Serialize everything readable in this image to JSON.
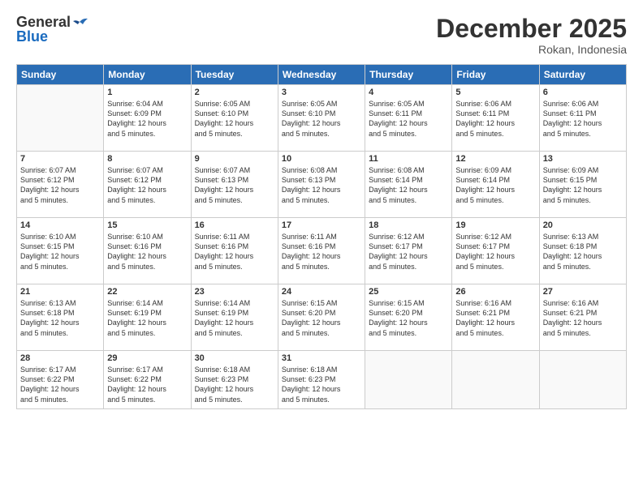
{
  "header": {
    "logo_general": "General",
    "logo_blue": "Blue",
    "month_title": "December 2025",
    "location": "Rokan, Indonesia"
  },
  "days_of_week": [
    "Sunday",
    "Monday",
    "Tuesday",
    "Wednesday",
    "Thursday",
    "Friday",
    "Saturday"
  ],
  "weeks": [
    [
      {
        "day": "",
        "info": ""
      },
      {
        "day": "1",
        "info": "Sunrise: 6:04 AM\nSunset: 6:09 PM\nDaylight: 12 hours\nand 5 minutes."
      },
      {
        "day": "2",
        "info": "Sunrise: 6:05 AM\nSunset: 6:10 PM\nDaylight: 12 hours\nand 5 minutes."
      },
      {
        "day": "3",
        "info": "Sunrise: 6:05 AM\nSunset: 6:10 PM\nDaylight: 12 hours\nand 5 minutes."
      },
      {
        "day": "4",
        "info": "Sunrise: 6:05 AM\nSunset: 6:11 PM\nDaylight: 12 hours\nand 5 minutes."
      },
      {
        "day": "5",
        "info": "Sunrise: 6:06 AM\nSunset: 6:11 PM\nDaylight: 12 hours\nand 5 minutes."
      },
      {
        "day": "6",
        "info": "Sunrise: 6:06 AM\nSunset: 6:11 PM\nDaylight: 12 hours\nand 5 minutes."
      }
    ],
    [
      {
        "day": "7",
        "info": "Sunrise: 6:07 AM\nSunset: 6:12 PM\nDaylight: 12 hours\nand 5 minutes."
      },
      {
        "day": "8",
        "info": "Sunrise: 6:07 AM\nSunset: 6:12 PM\nDaylight: 12 hours\nand 5 minutes."
      },
      {
        "day": "9",
        "info": "Sunrise: 6:07 AM\nSunset: 6:13 PM\nDaylight: 12 hours\nand 5 minutes."
      },
      {
        "day": "10",
        "info": "Sunrise: 6:08 AM\nSunset: 6:13 PM\nDaylight: 12 hours\nand 5 minutes."
      },
      {
        "day": "11",
        "info": "Sunrise: 6:08 AM\nSunset: 6:14 PM\nDaylight: 12 hours\nand 5 minutes."
      },
      {
        "day": "12",
        "info": "Sunrise: 6:09 AM\nSunset: 6:14 PM\nDaylight: 12 hours\nand 5 minutes."
      },
      {
        "day": "13",
        "info": "Sunrise: 6:09 AM\nSunset: 6:15 PM\nDaylight: 12 hours\nand 5 minutes."
      }
    ],
    [
      {
        "day": "14",
        "info": "Sunrise: 6:10 AM\nSunset: 6:15 PM\nDaylight: 12 hours\nand 5 minutes."
      },
      {
        "day": "15",
        "info": "Sunrise: 6:10 AM\nSunset: 6:16 PM\nDaylight: 12 hours\nand 5 minutes."
      },
      {
        "day": "16",
        "info": "Sunrise: 6:11 AM\nSunset: 6:16 PM\nDaylight: 12 hours\nand 5 minutes."
      },
      {
        "day": "17",
        "info": "Sunrise: 6:11 AM\nSunset: 6:16 PM\nDaylight: 12 hours\nand 5 minutes."
      },
      {
        "day": "18",
        "info": "Sunrise: 6:12 AM\nSunset: 6:17 PM\nDaylight: 12 hours\nand 5 minutes."
      },
      {
        "day": "19",
        "info": "Sunrise: 6:12 AM\nSunset: 6:17 PM\nDaylight: 12 hours\nand 5 minutes."
      },
      {
        "day": "20",
        "info": "Sunrise: 6:13 AM\nSunset: 6:18 PM\nDaylight: 12 hours\nand 5 minutes."
      }
    ],
    [
      {
        "day": "21",
        "info": "Sunrise: 6:13 AM\nSunset: 6:18 PM\nDaylight: 12 hours\nand 5 minutes."
      },
      {
        "day": "22",
        "info": "Sunrise: 6:14 AM\nSunset: 6:19 PM\nDaylight: 12 hours\nand 5 minutes."
      },
      {
        "day": "23",
        "info": "Sunrise: 6:14 AM\nSunset: 6:19 PM\nDaylight: 12 hours\nand 5 minutes."
      },
      {
        "day": "24",
        "info": "Sunrise: 6:15 AM\nSunset: 6:20 PM\nDaylight: 12 hours\nand 5 minutes."
      },
      {
        "day": "25",
        "info": "Sunrise: 6:15 AM\nSunset: 6:20 PM\nDaylight: 12 hours\nand 5 minutes."
      },
      {
        "day": "26",
        "info": "Sunrise: 6:16 AM\nSunset: 6:21 PM\nDaylight: 12 hours\nand 5 minutes."
      },
      {
        "day": "27",
        "info": "Sunrise: 6:16 AM\nSunset: 6:21 PM\nDaylight: 12 hours\nand 5 minutes."
      }
    ],
    [
      {
        "day": "28",
        "info": "Sunrise: 6:17 AM\nSunset: 6:22 PM\nDaylight: 12 hours\nand 5 minutes."
      },
      {
        "day": "29",
        "info": "Sunrise: 6:17 AM\nSunset: 6:22 PM\nDaylight: 12 hours\nand 5 minutes."
      },
      {
        "day": "30",
        "info": "Sunrise: 6:18 AM\nSunset: 6:23 PM\nDaylight: 12 hours\nand 5 minutes."
      },
      {
        "day": "31",
        "info": "Sunrise: 6:18 AM\nSunset: 6:23 PM\nDaylight: 12 hours\nand 5 minutes."
      },
      {
        "day": "",
        "info": ""
      },
      {
        "day": "",
        "info": ""
      },
      {
        "day": "",
        "info": ""
      }
    ]
  ]
}
